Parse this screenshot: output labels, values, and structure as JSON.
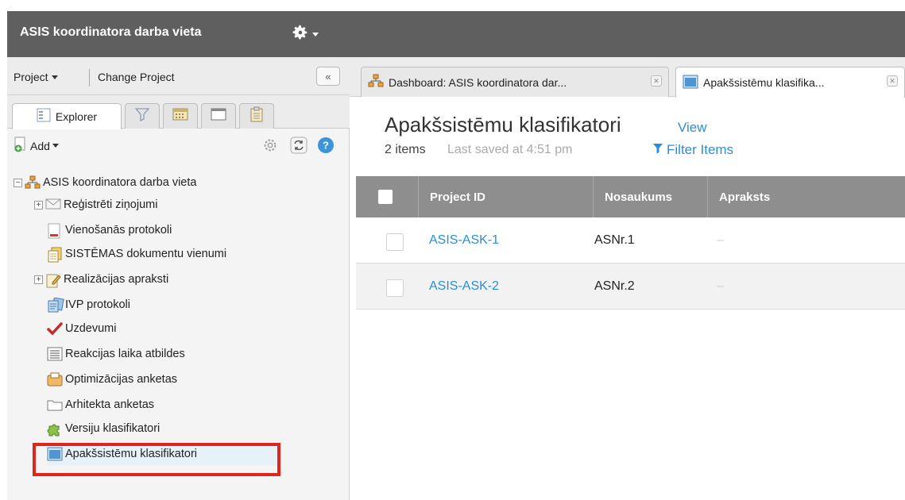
{
  "app": {
    "title": "ASIS koordinatora darba vieta",
    "accent": "#5f5f5f"
  },
  "left": {
    "project_menu": "Project",
    "change_project": "Change Project",
    "collapse": "«",
    "tabs": {
      "explorer": "Explorer"
    },
    "add_label": "Add",
    "tree": {
      "root": "ASIS koordinatora darba vieta",
      "items": [
        "Reģistrēti ziņojumi",
        "Vienošanās protokoli",
        "SISTĒMAS dokumentu vienumi",
        "Realizācijas apraksti",
        "IVP protokoli",
        "Uzdevumi",
        "Reakcijas laika atbildes",
        "Optimizācijas anketas",
        "Arhitekta anketas",
        "Versiju klasifikatori",
        "Apakšsistēmu klasifikatori"
      ]
    },
    "highlight_color": "#e0251c"
  },
  "right": {
    "tabs": [
      "Dashboard: ASIS koordinatora dar...",
      "Apakšsistēmu klasifika..."
    ],
    "page_title": "Apakšsistēmu klasifikatori",
    "view_link": "View",
    "item_count": "2 items",
    "last_saved": "Last saved at 4:51 pm",
    "filter_link": "Filter Items",
    "link_color": "#2a8fd6",
    "columns": [
      "Project ID",
      "Nosaukums",
      "Apraksts"
    ],
    "rows": [
      {
        "id": "ASIS-ASK-1",
        "name": "ASNr.1",
        "desc": "–"
      },
      {
        "id": "ASIS-ASK-2",
        "name": "ASNr.2",
        "desc": "–"
      }
    ]
  }
}
